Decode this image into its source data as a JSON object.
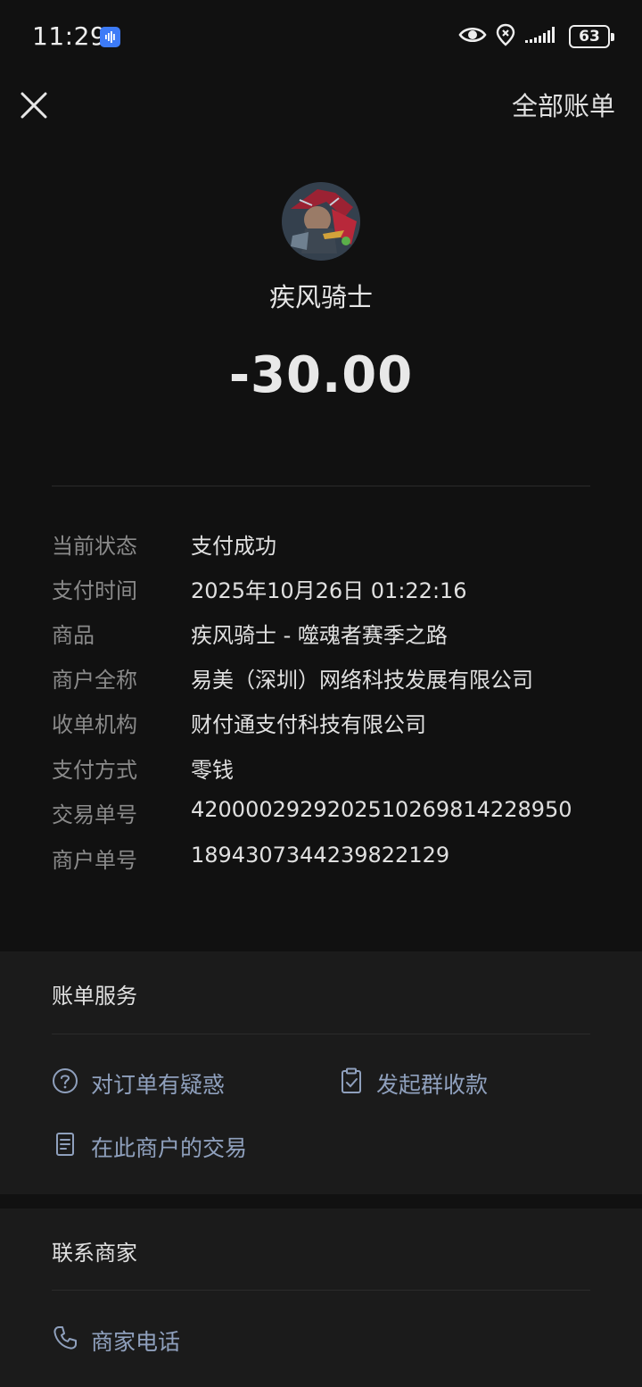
{
  "status_bar": {
    "time": "11:29",
    "battery": "63",
    "icons": [
      "voice-assistant-icon",
      "eye-icon",
      "location-icon",
      "signal-icon",
      "battery-icon"
    ]
  },
  "nav": {
    "close_icon": "close-icon",
    "all_bills_label": "全部账单"
  },
  "header": {
    "merchant_name": "疾风骑士",
    "amount": "-30.00"
  },
  "details": [
    {
      "label": "当前状态",
      "value": "支付成功"
    },
    {
      "label": "支付时间",
      "value": "2025年10月26日 01:22:16"
    },
    {
      "label": "商品",
      "value": "疾风骑士 - 噬魂者赛季之路"
    },
    {
      "label": "商户全称",
      "value": "易美（深圳）网络科技发展有限公司"
    },
    {
      "label": "收单机构",
      "value": "财付通支付科技有限公司"
    },
    {
      "label": "支付方式",
      "value": "零钱"
    },
    {
      "label": "交易单号",
      "value": "4200002929202510269814228950"
    },
    {
      "label": "商户单号",
      "value": "1894307344239822129"
    }
  ],
  "bill_service": {
    "title": "账单服务",
    "items": [
      {
        "label": "对订单有疑惑",
        "icon": "question-circle-icon"
      },
      {
        "label": "发起群收款",
        "icon": "clipboard-check-icon"
      },
      {
        "label": "在此商户的交易",
        "icon": "document-icon"
      }
    ]
  },
  "contact": {
    "title": "联系商家",
    "items": [
      {
        "label": "商家电话",
        "icon": "phone-icon"
      }
    ]
  },
  "colors": {
    "background": "#111111",
    "section_background": "#1b1b1b",
    "link": "#8fa0bd",
    "label": "#8a8a8a"
  }
}
